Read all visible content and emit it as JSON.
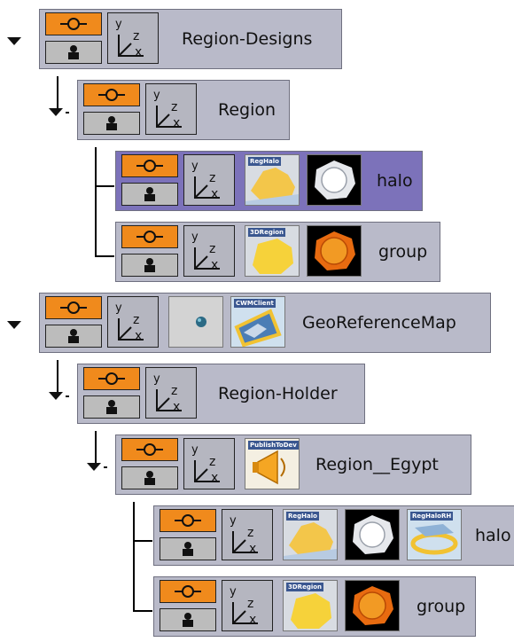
{
  "tree": {
    "nodes": [
      {
        "id": "region-designs",
        "label": "Region-Designs",
        "expanded": true,
        "selected": false,
        "thumbnails": []
      },
      {
        "id": "region",
        "label": "Region",
        "expanded": true,
        "selected": false,
        "thumbnails": []
      },
      {
        "id": "halo-1",
        "label": "halo",
        "expanded": false,
        "selected": true,
        "thumbnails": [
          {
            "caption": "RegHalo"
          },
          {
            "icon": "sphere"
          }
        ]
      },
      {
        "id": "group-1",
        "label": "group",
        "expanded": false,
        "selected": false,
        "thumbnails": [
          {
            "caption": "3DRegion"
          },
          {
            "icon": "orange-gem"
          }
        ]
      },
      {
        "id": "georeference-map",
        "label": "GeoReferenceMap",
        "expanded": true,
        "selected": false,
        "thumbnails": [
          {
            "icon": "dot"
          },
          {
            "caption": "CWMClient"
          }
        ]
      },
      {
        "id": "region-holder",
        "label": "Region-Holder",
        "expanded": true,
        "selected": false,
        "thumbnails": []
      },
      {
        "id": "region-egypt",
        "label": "Region__Egypt",
        "expanded": true,
        "selected": false,
        "thumbnails": [
          {
            "caption": "PublishToDev"
          }
        ]
      },
      {
        "id": "halo-2",
        "label": "halo",
        "expanded": false,
        "selected": false,
        "thumbnails": [
          {
            "caption": "RegHalo"
          },
          {
            "icon": "sphere"
          },
          {
            "caption": "RegHaloRH"
          }
        ]
      },
      {
        "id": "group-2",
        "label": "group",
        "expanded": false,
        "selected": false,
        "thumbnails": [
          {
            "caption": "3DRegion"
          },
          {
            "icon": "orange-gem"
          }
        ]
      }
    ],
    "axis_letters": {
      "y": "y",
      "z": "z",
      "x": "x"
    }
  },
  "colors": {
    "node_bg": "#b9bac9",
    "node_selected_bg": "#7c72ba",
    "visibility_button": "#f08a1c",
    "lock_button": "#bcbcbc"
  }
}
